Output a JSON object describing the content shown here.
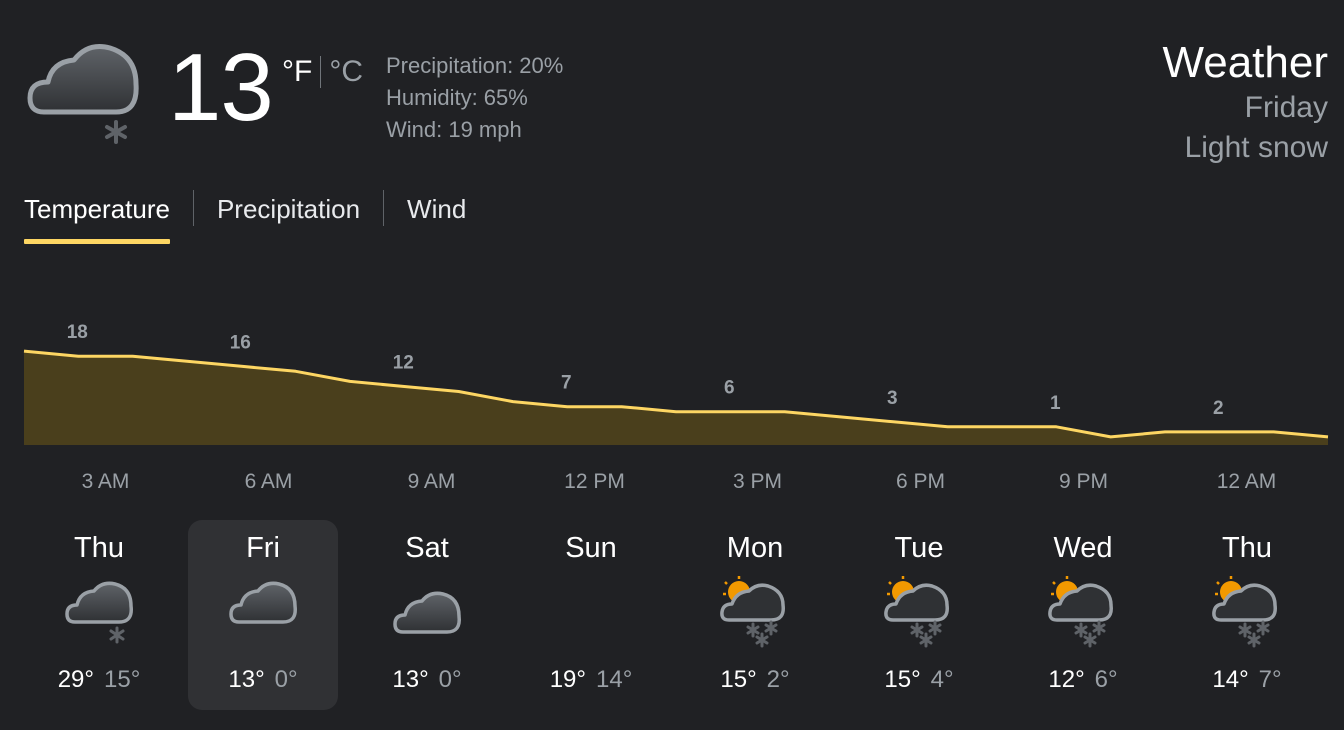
{
  "current": {
    "icon": "cloud-snow-icon",
    "temperature": "13",
    "unit_f": "°F",
    "unit_c": "°C",
    "precipitation": "Precipitation: 20%",
    "humidity": "Humidity: 65%",
    "wind": "Wind: 19 mph"
  },
  "header": {
    "title": "Weather",
    "day": "Friday",
    "condition": "Light snow"
  },
  "tabs": [
    {
      "label": "Temperature",
      "active": true
    },
    {
      "label": "Precipitation",
      "active": false
    },
    {
      "label": "Wind",
      "active": false
    }
  ],
  "chart_data": {
    "type": "area",
    "series": [
      {
        "values": [
          18,
          17,
          17,
          16,
          15,
          14,
          12,
          11,
          10,
          8,
          7,
          7,
          6,
          6,
          6,
          5,
          4,
          3,
          3,
          3,
          1,
          2,
          2,
          2,
          1
        ]
      }
    ],
    "data_labels": [
      {
        "index": 1,
        "label": "18"
      },
      {
        "index": 4,
        "label": "16"
      },
      {
        "index": 7,
        "label": "12"
      },
      {
        "index": 10,
        "label": "7"
      },
      {
        "index": 13,
        "label": "6"
      },
      {
        "index": 16,
        "label": "3"
      },
      {
        "index": 19,
        "label": "1"
      },
      {
        "index": 22,
        "label": "2"
      }
    ],
    "xticks": [
      {
        "index": 1.5,
        "label": "3 AM"
      },
      {
        "index": 4.5,
        "label": "6 AM"
      },
      {
        "index": 7.5,
        "label": "9 AM"
      },
      {
        "index": 10.5,
        "label": "12 PM"
      },
      {
        "index": 13.5,
        "label": "3 PM"
      },
      {
        "index": 16.5,
        "label": "6 PM"
      },
      {
        "index": 19.5,
        "label": "9 PM"
      },
      {
        "index": 22.5,
        "label": "12 AM"
      }
    ],
    "line_color": "#fdd663",
    "fill_color": "#4a3f1c",
    "grid": false
  },
  "days": [
    {
      "name": "Thu",
      "icon": "cloud-snow-icon",
      "high": "29°",
      "low": "15°",
      "selected": false
    },
    {
      "name": "Fri",
      "icon": "cloud-icon",
      "high": "13°",
      "low": "0°",
      "selected": true
    },
    {
      "name": "Sat",
      "icon": "cloud-icon",
      "high": "13°",
      "low": "0°",
      "selected": false
    },
    {
      "name": "Sun",
      "icon": "",
      "high": "19°",
      "low": "14°",
      "selected": false
    },
    {
      "name": "Mon",
      "icon": "partly-sunny-snow-icon",
      "high": "15°",
      "low": "2°",
      "selected": false
    },
    {
      "name": "Tue",
      "icon": "partly-sunny-snow-icon",
      "high": "15°",
      "low": "4°",
      "selected": false
    },
    {
      "name": "Wed",
      "icon": "partly-sunny-snow-icon",
      "high": "12°",
      "low": "6°",
      "selected": false
    },
    {
      "name": "Thu",
      "icon": "partly-sunny-snow-icon",
      "high": "14°",
      "low": "7°",
      "selected": false
    }
  ],
  "colors": {
    "accent": "#fdd663",
    "background": "#202124",
    "selected_day": "#303134",
    "secondary_text": "#9aa0a6"
  }
}
